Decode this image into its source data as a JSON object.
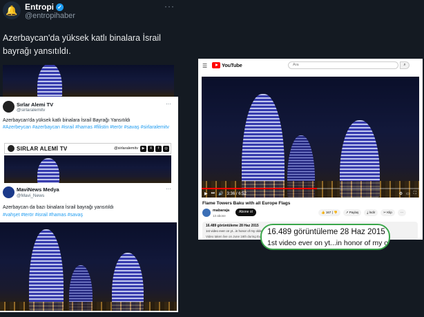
{
  "tweet": {
    "author_name": "Entropi",
    "author_handle": "@entropihaber",
    "more": "···",
    "text": "Azerbaycan'da yüksek katlı binalara İsrail bayrağı yansıtıldı."
  },
  "embedded_post_1": {
    "name": "Sırlar Alemi TV",
    "handle": "@sirlaralemitv",
    "more": "···",
    "text": "Azerbaycan'da yüksek katlı binalara İsrail Bayrağı Yansıtıldı",
    "hashtags": "#Azerbeycan #azerbaycan #israil #hamas #filistin #terör #savaş #sirlaralemitv",
    "banner_title": "SIRLAR ALEMİ TV",
    "banner_handle": "@sirlaralemitv"
  },
  "embedded_post_2": {
    "name": "MaviNews Medya",
    "handle": "@Mavi_News",
    "more": "···",
    "text": "Azerbaycan da bazı binalara İsrail bayrağı yansıtıldı",
    "hashtags": "#vahşet #terör #israil #hamas #savaş"
  },
  "youtube": {
    "menu": "☰",
    "brand": "YouTube",
    "search_placeholder": "Ara",
    "search_icon": "⌕",
    "time": "3:36 / 6:52",
    "progress": 0.53,
    "video_title": "Flame Towers Baku with all Europe Flags",
    "channel": "mabaraja",
    "subscribers": "13 abone",
    "subscribe_label": "Abone ol",
    "likes": "167",
    "share_label": "Paylaş",
    "download_label": "İndir",
    "clip_label": "Klip",
    "desc_stats": "16.489 görüntüleme  28 Haz 2015",
    "desc_line": "1st video ever on yt...in honor of my olde",
    "desc_more": "Video taken live on June 16th during Eurovision..."
  },
  "zoom": {
    "stats": "16.489 görüntüleme  28 Haz 2015",
    "line": "1st video ever on yt...in honor of my olde"
  },
  "colors": {
    "accent": "#3aa64a",
    "brand": "#ff0000",
    "link": "#1d9bf0"
  }
}
